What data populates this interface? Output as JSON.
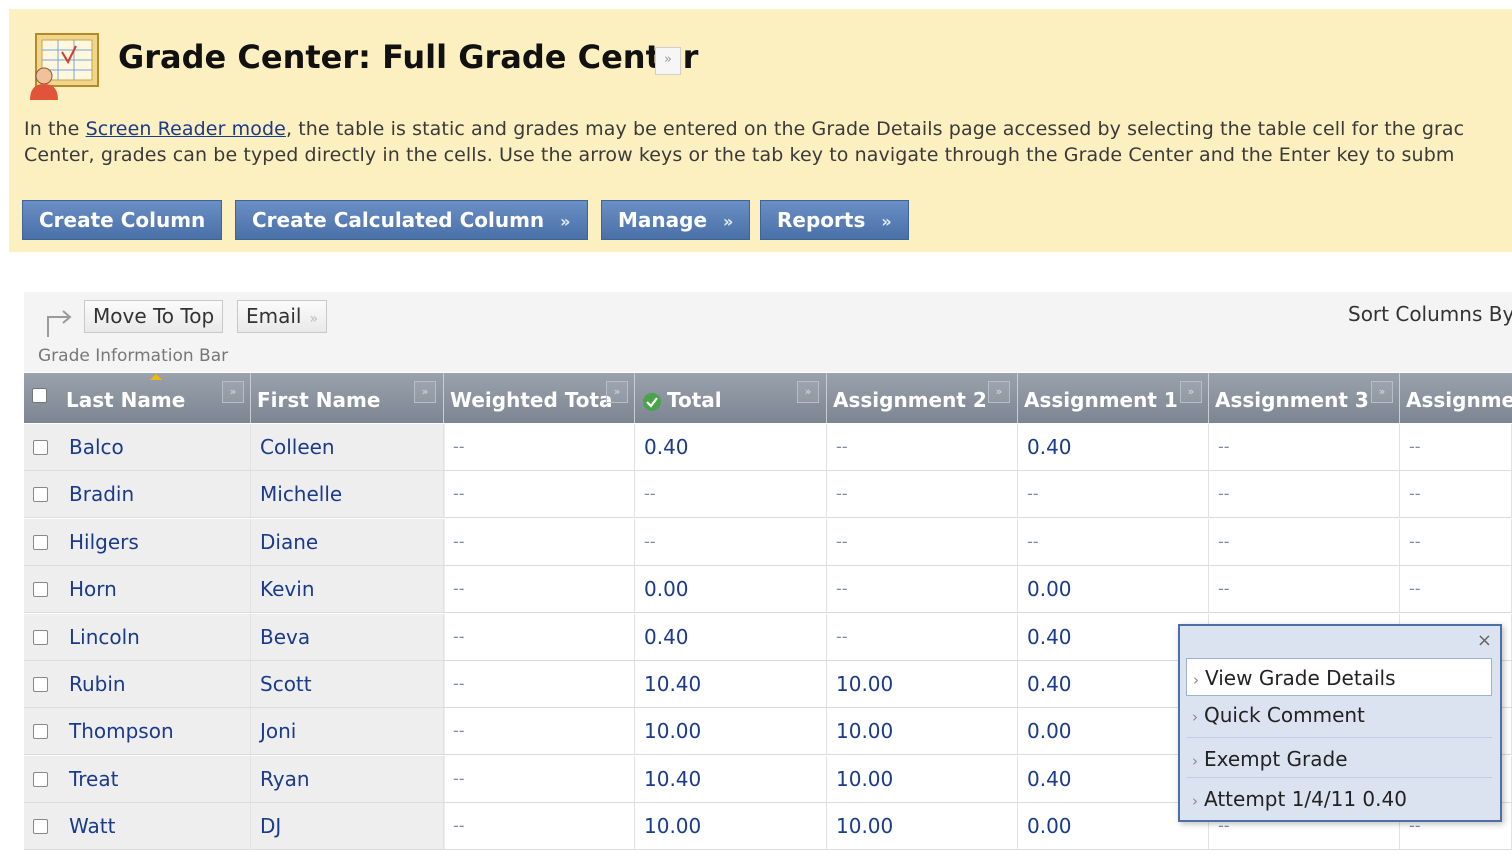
{
  "header": {
    "title": "Grade Center: Full Grade Center",
    "title_menu_icon": "double-chevron-down-icon",
    "instructions": {
      "line1_prefix": "In the ",
      "line1_link": "Screen Reader mode",
      "line1_suffix": ", the table is static and grades may be entered on the Grade Details page accessed by selecting the table cell for the grac",
      "line2": "Center, grades can be typed directly in the cells. Use the arrow keys or the tab key to navigate through the Grade Center and the Enter key to subm"
    },
    "action_buttons": {
      "create_column": "Create Column",
      "create_calculated_column": "Create Calculated Column",
      "manage": "Manage",
      "reports": "Reports",
      "chevron": "»"
    },
    "colors": {
      "band": "#fcefc0",
      "button": "#5a80b8"
    }
  },
  "toolbar": {
    "move_to_top": "Move To Top",
    "email": "Email",
    "sort_columns": "Sort Columns By",
    "grade_info_bar": "Grade Information Bar"
  },
  "columns": [
    "Last Name",
    "First Name",
    "Weighted Tota",
    "Total",
    "Assignment 2",
    "Assignment 1",
    "Assignment 3",
    "Assignme"
  ],
  "rows": [
    {
      "last": "Balco",
      "first": "Colleen",
      "cells": [
        "--",
        "0.40",
        "--",
        "0.40",
        "--",
        "--"
      ]
    },
    {
      "last": "Bradin",
      "first": "Michelle",
      "cells": [
        "--",
        "--",
        "--",
        "--",
        "--",
        "--"
      ]
    },
    {
      "last": "Hilgers",
      "first": "Diane",
      "cells": [
        "--",
        "--",
        "--",
        "--",
        "--",
        "--"
      ]
    },
    {
      "last": "Horn",
      "first": "Kevin",
      "cells": [
        "--",
        "0.00",
        "--",
        "0.00",
        "--",
        "--"
      ]
    },
    {
      "last": "Lincoln",
      "first": "Beva",
      "cells": [
        "--",
        "0.40",
        "--",
        "0.40",
        "",
        ""
      ]
    },
    {
      "last": "Rubin",
      "first": "Scott",
      "cells": [
        "--",
        "10.40",
        "10.00",
        "0.40",
        "",
        ""
      ]
    },
    {
      "last": "Thompson",
      "first": "Joni",
      "cells": [
        "--",
        "10.00",
        "10.00",
        "0.00",
        "",
        ""
      ]
    },
    {
      "last": "Treat",
      "first": "Ryan",
      "cells": [
        "--",
        "10.40",
        "10.00",
        "0.40",
        "",
        ""
      ]
    },
    {
      "last": "Watt",
      "first": "DJ",
      "cells": [
        "--",
        "10.00",
        "10.00",
        "0.00",
        "--",
        "--"
      ]
    }
  ],
  "context_menu": {
    "close": "×",
    "items": [
      "View Grade Details",
      "Quick Comment",
      "Exempt Grade",
      "Attempt 1/4/11 0.40"
    ]
  }
}
